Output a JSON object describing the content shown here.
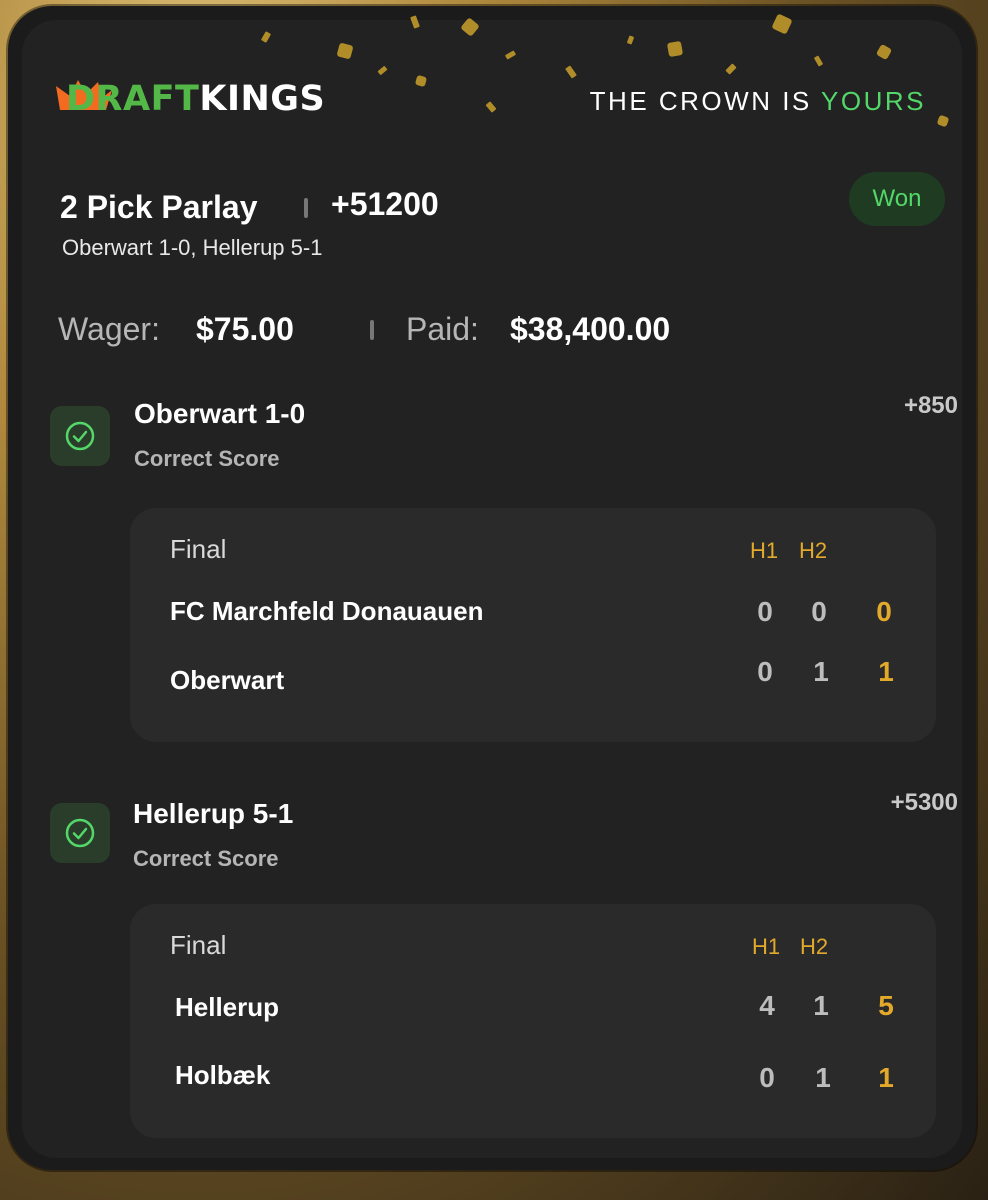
{
  "brand": {
    "logo_draft": "DRAFT",
    "logo_kings": "KINGS",
    "tagline_main": "THE CROWN IS",
    "tagline_highlight": "YOURS",
    "accent_green": "#53d769",
    "accent_gold": "#e3a92b"
  },
  "bet": {
    "title": "2 Pick Parlay",
    "odds": "+51200",
    "subtitle": "Oberwart 1-0, Hellerup 5-1",
    "status": "Won",
    "wager_label": "Wager:",
    "wager_value": "$75.00",
    "paid_label": "Paid:",
    "paid_value": "$38,400.00"
  },
  "legs": [
    {
      "title": "Oberwart 1-0",
      "type": "Correct Score",
      "odds": "+850",
      "result": {
        "status": "Final",
        "h1_label": "H1",
        "h2_label": "H2",
        "teams": [
          {
            "name": "FC Marchfeld Donauauen",
            "h1": "0",
            "h2": "0",
            "total": "0"
          },
          {
            "name": "Oberwart",
            "h1": "0",
            "h2": "1",
            "total": "1"
          }
        ]
      }
    },
    {
      "title": "Hellerup 5-1",
      "type": "Correct Score",
      "odds": "+5300",
      "result": {
        "status": "Final",
        "h1_label": "H1",
        "h2_label": "H2",
        "teams": [
          {
            "name": "Hellerup",
            "h1": "4",
            "h2": "1",
            "total": "5"
          },
          {
            "name": "Holbæk",
            "h1": "0",
            "h2": "1",
            "total": "1"
          }
        ]
      }
    }
  ]
}
